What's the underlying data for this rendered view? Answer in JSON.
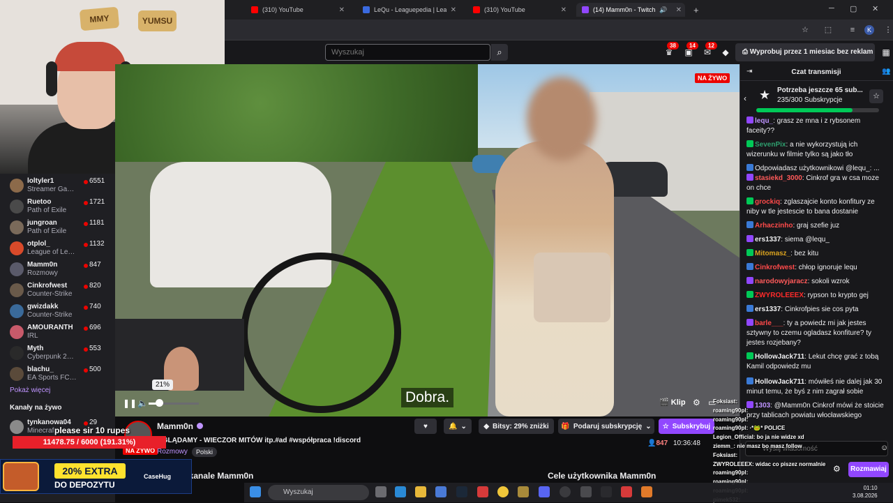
{
  "browser": {
    "tabs": [
      {
        "label": "(310) YouTube",
        "favicon": "youtube-icon"
      },
      {
        "label": "LeQu - Leaguepedia | League o",
        "favicon": "leaguepedia-icon"
      },
      {
        "label": "(310) YouTube",
        "favicon": "youtube-icon"
      },
      {
        "label": "(14) Mamm0n - Twitch",
        "favicon": "twitch-icon"
      }
    ],
    "new_tab": "+",
    "profile_initial": "K"
  },
  "topnav": {
    "search_placeholder": "Wyszukaj",
    "badges": [
      "38",
      "14",
      "12"
    ],
    "promo": "Wyprobuj przez 1 miesiac bez reklam"
  },
  "sidebar": {
    "channels": [
      {
        "name": "loltyler1",
        "game": "Streamer Games",
        "viewers": "6551",
        "color": "#8c6a4a"
      },
      {
        "name": "Ruetoo",
        "game": "Path of Exile",
        "viewers": "1721",
        "color": "#4a4a4a"
      },
      {
        "name": "jungroan",
        "game": "Path of Exile",
        "viewers": "1181",
        "color": "#7a6a5a"
      },
      {
        "name": "otplol_",
        "game": "League of Lege...",
        "viewers": "1132",
        "color": "#d94a2a"
      },
      {
        "name": "Mamm0n",
        "game": "Rozmowy",
        "viewers": "847",
        "color": "#5a5a6a"
      },
      {
        "name": "Cinkrofwest",
        "game": "Counter-Strike",
        "viewers": "820",
        "color": "#6a5a4a"
      },
      {
        "name": "gwizdakk",
        "game": "Counter-Strike",
        "viewers": "740",
        "color": "#3a6a9a"
      },
      {
        "name": "AMOURANTH",
        "game": "IRL",
        "viewers": "696",
        "color": "#c85a6a"
      },
      {
        "name": "Myth",
        "game": "Cyberpunk 2077",
        "viewers": "553",
        "color": "#2a2a2a"
      },
      {
        "name": "blachu_",
        "game": "EA Sports FC 26",
        "viewers": "500",
        "color": "#5a4a3a"
      }
    ],
    "show_more": "Pokaż więcej",
    "live_channels": "Kanały na żywo",
    "live_channel": {
      "name": "tynkanowa04",
      "game": "Minecraf",
      "viewers": "29"
    }
  },
  "video": {
    "live_flag": "NA ŻYWO",
    "subtitle": "Dobra.",
    "volume_pct": "21%",
    "volume_level": 0.21,
    "clip_label": "Klip"
  },
  "channel": {
    "name": "Mamm0n",
    "title": "OGLĄDAMY - WIECZOR MITÓW itp.#ad #współpraca !discord",
    "category": "Rozmowy",
    "tag": "Polski",
    "live_badge": "NA ŻYWO",
    "viewers": "847",
    "uptime": "10:36:48",
    "about": "O kanale Mamm0n",
    "goals": "Cele użytkownika Mamm0n",
    "bits_label": "Bitsy: 29% zniżki",
    "gift_label": "Podaruj subskrypcję",
    "subscribe_label": "Subskrybuj"
  },
  "chat": {
    "header": "Czat transmisji",
    "subgoal_title": "Potrzeba jeszcze 65 sub...",
    "subgoal_count": "235/300 Subskrypcje",
    "subgoal_progress": 0.783,
    "messages": [
      {
        "user": "lequ_",
        "color": "#bf94ff",
        "text": ": grasz ze mna i z rybsonem faceity??"
      },
      {
        "user": "SevenPix",
        "color": "#2e9e6e",
        "text": ": a nie wykorzystują ich wizerunku w filmie tylko są jako tło"
      },
      {
        "user": "",
        "color": "#efeff1",
        "text": "Odpowiadasz użytkownikowi @lequ_: ..."
      },
      {
        "user": "stasiekd_3000",
        "color": "#ff5a5a",
        "text": ": Cinkrof gra w csa moze on chce"
      },
      {
        "user": "grockiq",
        "color": "#ff4a4a",
        "text": ": zglaszajcie konto konfitury ze niby w tle jestescie to bana dostanie"
      },
      {
        "user": "Arhaczinho",
        "color": "#ff4a4a",
        "text": ": graj szefie juz"
      },
      {
        "user": "ers1337",
        "color": "#efeff1",
        "text": ": siema @lequ_"
      },
      {
        "user": "Mitomasz_",
        "color": "#d9a21f",
        "text": ": bez kitu"
      },
      {
        "user": "Cinkrofwest",
        "color": "#ff4a4a",
        "text": ": chłop ignoruje lequ"
      },
      {
        "user": "narodowyjaracz",
        "color": "#ff5a5a",
        "text": ": sokoli wzrok"
      },
      {
        "user": "ZWYROLEEEX",
        "color": "#ff2a2a",
        "text": ": rypson to krypto gej"
      },
      {
        "user": "ers1337",
        "color": "#efeff1",
        "text": ": Cinkrofpies sie cos pyta"
      },
      {
        "user": "barle___",
        "color": "#ff4a4a",
        "text": ": ty a powiedz mi jak jestes sztywny to czemu ogladasz konfiture? ty jestes rozjebany?"
      },
      {
        "user": "HollowJack711",
        "color": "#efeff1",
        "text": ": Lekut chcę grać z tobą Kamil odpowiedz mu"
      },
      {
        "user": "HollowJack711",
        "color": "#efeff1",
        "text": ": mówiłeś nie dalej jak 30 minut temu, że byś z nim zagrał sobie"
      },
      {
        "user": "1303",
        "color": "#bf94ff",
        "text": ": @Mamm0n Cinkrof mówi że stoicie przy tablicach powiatu włocławskiego"
      }
    ],
    "input_placeholder": "Wyślij wiadomość",
    "send_label": "Rozmawiaj"
  },
  "overlay": {
    "donation_text": "please sir 10 rupes",
    "donation_bar": "11478.75 / 6000 (191.31%)",
    "ad_line1": "20% EXTRA",
    "ad_line2": "DO DEPOZYTU",
    "ad_brand": "CaseHug",
    "overlay_chat": [
      "Foksiast: ",
      "roaming90pl: ",
      "roaming90pl: ",
      "roaming90pl: ·*🐸* POLICE",
      "Legion_Official: bo ja nie widze xd",
      "ziemm_: nie masz bo masz follow",
      "Foksiast: ",
      "ZWYROLEEEX: widac co piszez normalnie",
      "roaming90pl: ",
      "roaming90pl: ",
      "roaming90pl: ",
      "pimek532: "
    ],
    "webcam_signs": [
      "MMY",
      "YUMSU"
    ]
  },
  "taskbar": {
    "search": "Wyszukaj",
    "time": "01:10",
    "date": "3.08.2026"
  }
}
